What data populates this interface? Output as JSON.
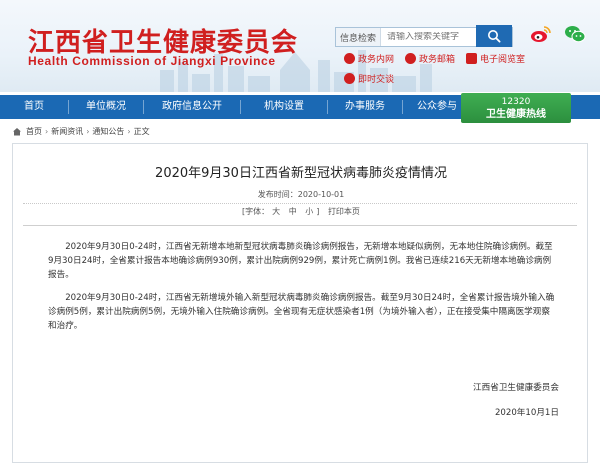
{
  "header": {
    "title_cn": "江西省卫生健康委员会",
    "title_en": "Health Commission of Jiangxi Province",
    "search": {
      "label": "信息检索",
      "placeholder": "请输入搜索关键字"
    },
    "social_icons": [
      "weibo-icon",
      "wechat-icon"
    ],
    "quick_links": [
      {
        "label": "政务内网",
        "icon": "globe-icon"
      },
      {
        "label": "政务邮箱",
        "icon": "mail-icon"
      },
      {
        "label": "电子阅览室",
        "icon": "monitor-icon"
      },
      {
        "label": "即时交谈",
        "icon": "chat-icon"
      }
    ]
  },
  "nav": {
    "items": [
      "首页",
      "单位概况",
      "政府信息公开",
      "机构设置",
      "办事服务",
      "公众参与"
    ],
    "hotline": {
      "number": "12320",
      "label": "卫生健康热线"
    }
  },
  "breadcrumb": [
    "首页",
    "新闻资讯",
    "通知公告",
    "正文"
  ],
  "article": {
    "title": "2020年9月30日江西省新型冠状病毒肺炎疫情情况",
    "publish": "发布时间：2020-10-01",
    "font_label": "[字体：",
    "font_large": "大",
    "font_medium": "中",
    "font_small": "小",
    "font_close": "]",
    "print": "打印本页",
    "paragraphs": [
      "2020年9月30日0-24时，江西省无新增本地新型冠状病毒肺炎确诊病例报告，无新增本地疑似病例，无本地住院确诊病例。截至9月30日24时，全省累计报告本地确诊病例930例，累计出院病例929例，累计死亡病例1例。我省已连续216天无新增本地确诊病例报告。",
      "2020年9月30日0-24时，江西省无新增境外输入新型冠状病毒肺炎确诊病例报告。截至9月30日24时，全省累计报告境外输入确诊病例5例，累计出院病例5例，无境外输入住院确诊病例。全省现有无症状感染者1例（为境外输入者），正在接受集中隔离医学观察和治疗。"
    ],
    "signature": "江西省卫生健康委员会",
    "date": "2020年10月1日"
  },
  "colors": {
    "brand_red": "#d01f1f",
    "nav_blue": "#1b69b4",
    "hotline_green": "#2c8f3e"
  }
}
